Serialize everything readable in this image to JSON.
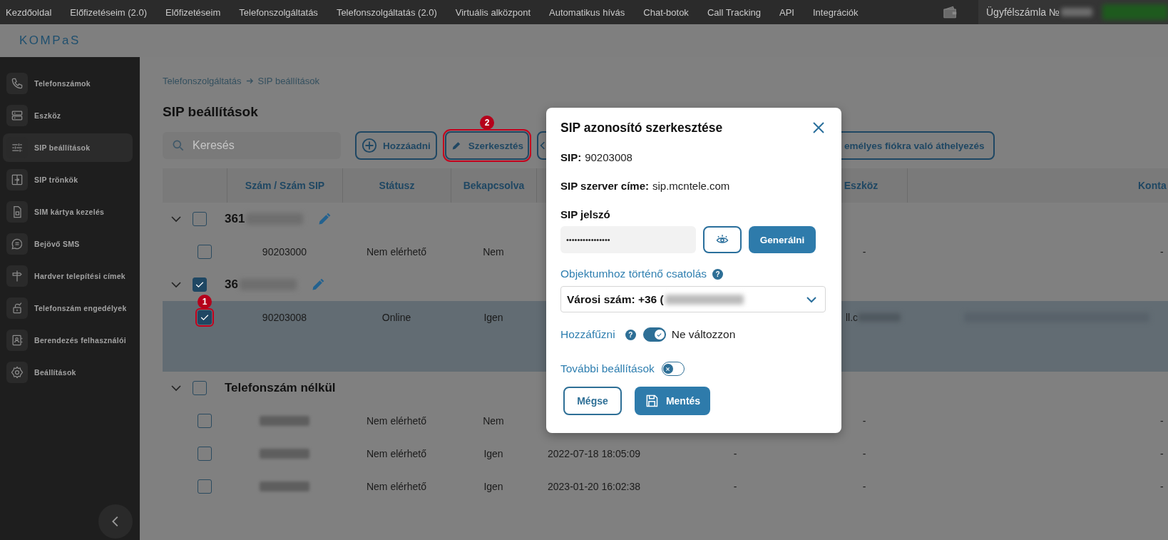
{
  "top_nav": {
    "items": [
      "Kezdőoldal",
      "Előfizetéseim (2.0)",
      "Előfizetéseim",
      "Telefonszolgáltatás",
      "Telefonszolgáltatás (2.0)",
      "Virtuális alközpont",
      "Automatikus hívás",
      "Chat-botok",
      "Call Tracking",
      "API",
      "Integrációk"
    ],
    "account": {
      "label": "Ügyfélszámla №",
      "value_redacted": true
    }
  },
  "logo": "KOMPaS",
  "sidebar": {
    "items": [
      {
        "label": "Telefonszámok",
        "selected": false
      },
      {
        "label": "Eszköz",
        "selected": false
      },
      {
        "label": "SIP beállítások",
        "selected": true
      },
      {
        "label": "SIP trönkök",
        "selected": false
      },
      {
        "label": "SIM kártya kezelés",
        "selected": false
      },
      {
        "label": "Bejövő SMS",
        "selected": false
      },
      {
        "label": "Hardver telepítési címek",
        "selected": false
      },
      {
        "label": "Telefonszám engedélyek",
        "selected": false
      },
      {
        "label": "Berendezés felhasználói",
        "selected": false
      },
      {
        "label": "Beállítások",
        "selected": false
      }
    ]
  },
  "breadcrumb": [
    "Telefonszolgáltatás",
    "SIP beállítások"
  ],
  "page_title": "SIP beállítások",
  "toolbar": {
    "search": {
      "placeholder": "Keresés"
    },
    "buttons": [
      {
        "kind": "add",
        "label": "Hozzáadni"
      },
      {
        "kind": "edit",
        "label": "Szerkesztés",
        "annotation": "2"
      },
      {
        "kind": "covered"
      },
      {
        "kind": "move",
        "label": "emélyes fiókra való áthelyezés"
      }
    ]
  },
  "table": {
    "columns": [
      {
        "label": "Szám / Szám SIP"
      },
      {
        "label": "Státusz"
      },
      {
        "label": "Bekapcsolva"
      },
      {
        "label": "Eszköz"
      },
      {
        "label": "Konta"
      }
    ],
    "groups": [
      {
        "label": "361",
        "label_redacted": true,
        "expanded": true,
        "checked": false,
        "editable": true,
        "rows": [
          {
            "selected": false,
            "checked": false,
            "number": "90203000",
            "status": "Nem elérhető",
            "enabled": "Nem",
            "eszkoz": "-",
            "konta": "-"
          }
        ]
      },
      {
        "label": "36",
        "label_redacted": true,
        "expanded": true,
        "checked": true,
        "editable": true,
        "rows": [
          {
            "selected": true,
            "checked": true,
            "annotation": "1",
            "number": "90203008",
            "status": "Online",
            "enabled": "Igen",
            "eszkoz": "ll.c",
            "eszkoz_redacted": true,
            "konta_redacted": true
          }
        ]
      },
      {
        "label": "Telefonszám nélkül",
        "expanded": true,
        "checked": false,
        "editable": false,
        "rows": [
          {
            "selected": false,
            "checked": false,
            "number_redacted": true,
            "status": "Nem elérhető",
            "enabled": "Nem",
            "eszkoz": "-",
            "konta": "-"
          },
          {
            "selected": false,
            "checked": false,
            "number_redacted": true,
            "status": "Nem elérhető",
            "enabled": "Igen",
            "column_5": "2022-07-18 18:05:09",
            "column_6": "-",
            "eszkoz": "-",
            "konta": "-"
          },
          {
            "selected": false,
            "checked": false,
            "number_redacted": true,
            "status": "Nem elérhető",
            "enabled": "Igen",
            "column_5": "2023-01-20 16:02:38",
            "column_6": "-",
            "eszkoz": "-",
            "konta": "-"
          }
        ]
      }
    ]
  },
  "dialog": {
    "title": "SIP azonosító szerkesztése",
    "fields": [
      {
        "label": "SIP:",
        "value": "90203008"
      },
      {
        "label": "SIP szerver címe:",
        "value": "sip.mcntele.com"
      }
    ],
    "password": {
      "label": "SIP jelszó",
      "value": "••••••••••••••••",
      "generate_button": "Generálni"
    },
    "binding": {
      "label": "Objektumhoz történő csatolás",
      "help": "?",
      "value": "Városi szám: +36 (",
      "value_redacted": true
    },
    "append": {
      "label": "Hozzáfűzni",
      "help": "?",
      "on": true,
      "option": "Ne változzon"
    },
    "more_settings": {
      "label": "További beállítások",
      "on": false
    },
    "buttons": [
      {
        "kind": "secondary",
        "label": "Mégse"
      },
      {
        "kind": "primary",
        "label": "Mentés"
      }
    ]
  }
}
